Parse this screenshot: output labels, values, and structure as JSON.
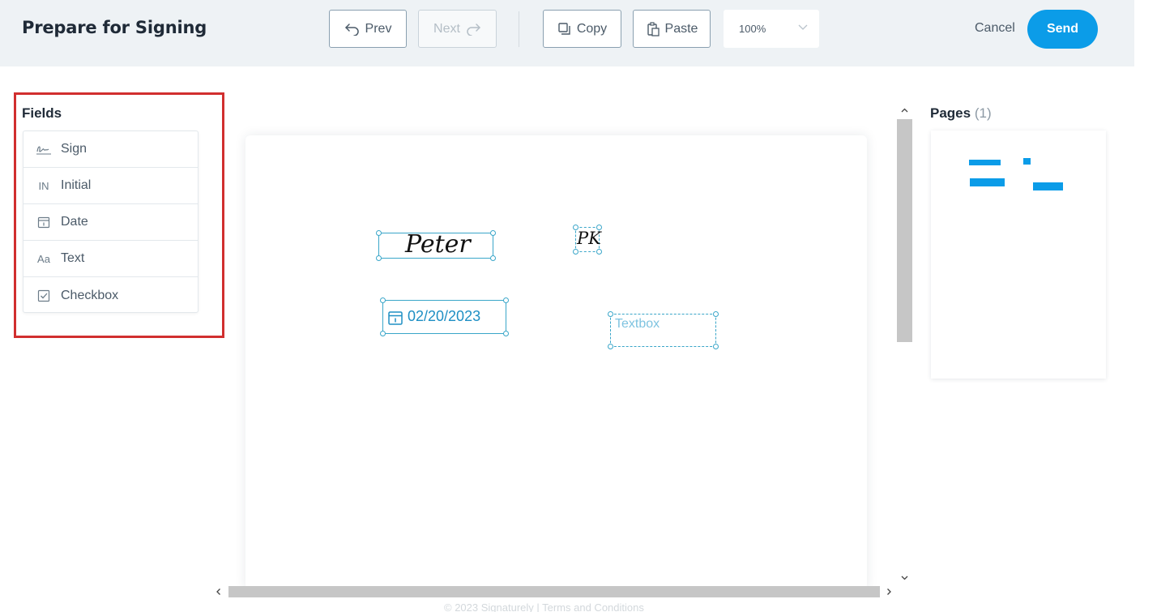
{
  "header": {
    "title": "Prepare for Signing",
    "prev_label": "Prev",
    "next_label": "Next",
    "copy_label": "Copy",
    "paste_label": "Paste",
    "zoom_value": "100%",
    "cancel_label": "Cancel",
    "send_label": "Send"
  },
  "fields_panel": {
    "title": "Fields",
    "items": [
      {
        "label": "Sign",
        "icon": "signature-icon"
      },
      {
        "label": "Initial",
        "icon": "initial-icon",
        "glyph": "IN"
      },
      {
        "label": "Date",
        "icon": "calendar-icon"
      },
      {
        "label": "Text",
        "icon": "text-icon",
        "glyph": "Aa"
      },
      {
        "label": "Checkbox",
        "icon": "checkbox-icon"
      }
    ]
  },
  "document": {
    "signature_value": "Peter",
    "initials_value": "PK",
    "date_value": "02/20/2023",
    "textbox_placeholder": "Textbox"
  },
  "pages_panel": {
    "title": "Pages",
    "count": "(1)"
  },
  "footer": {
    "text": "© 2023 Signaturely | Terms and Conditions"
  },
  "colors": {
    "accent": "#0b9ce8",
    "field_border": "#3aa6c9",
    "highlight": "#d12f2f"
  }
}
